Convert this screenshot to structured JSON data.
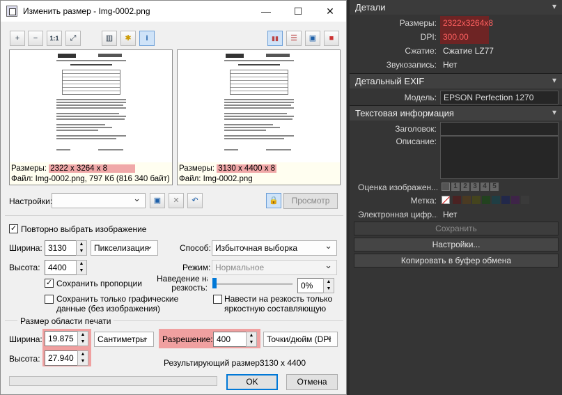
{
  "window": {
    "title": "Изменить размер - Img-0002.png",
    "minimize": "—",
    "maximize": "☐",
    "close": "✕"
  },
  "toolbar": {
    "zoom_in": "+",
    "zoom_out": "−",
    "one_to_one": "1:1",
    "fit": "⤢",
    "histogram": "▥",
    "effects": "✱",
    "info": "i",
    "view_side": "▮▮",
    "view_stack": "☰",
    "view_single": "▣",
    "view_after": "■"
  },
  "previews": {
    "left": {
      "size_label": "Размеры:",
      "size_value": "2322 x 3264 x 8",
      "file_line": "Файл: Img-0002.png, 797 Кб (816 340 байт)"
    },
    "right": {
      "size_label": "Размеры:",
      "size_value": "3130 x 4400 x 8",
      "file_line": "Файл: Img-0002.png"
    }
  },
  "settings": {
    "label": "Настройки:",
    "value": "",
    "preview_button": "Просмотр"
  },
  "reselect": {
    "label": "Повторно выбрать изображение",
    "checked": true
  },
  "size": {
    "width_label": "Ширина:",
    "width_value": "3130",
    "height_label": "Высота:",
    "height_value": "4400",
    "unit": "Пикселизация",
    "keep_ratio_label": "Сохранить пропорции",
    "keep_ratio_checked": true,
    "graphic_only_label_1": "Сохранить только графические",
    "graphic_only_label_2": "данные (без изображения)",
    "graphic_only_checked": false
  },
  "method": {
    "label": "Способ:",
    "value": "Избыточная выборка",
    "mode_label": "Режим:",
    "mode_value": "Нормальное",
    "sharpen_label_1": "Наведение на",
    "sharpen_label_2": "резкость:",
    "sharpen_value": "0%",
    "sharpen_level": 0,
    "sharpen_bright_label_1": "Навести на резкость только",
    "sharpen_bright_label_2": "яркостную составляющую",
    "sharpen_bright_checked": false
  },
  "print": {
    "group_label": "Размер области печати",
    "width_label": "Ширина:",
    "width_value": "19.875",
    "height_label": "Высота:",
    "height_value": "27.940",
    "unit": "Сантиметры",
    "resolution_label": "Разрешение:",
    "resolution_value": "400",
    "resolution_unit": "Точки/дюйм (DPI",
    "result_label": "Результирующий размер:",
    "result_value": "3130 x 4400"
  },
  "footer": {
    "ok": "OK",
    "cancel": "Отмена"
  },
  "panel": {
    "details_header": "Детали",
    "dims_label": "Размеры:",
    "dims_value": "2322x3264x8",
    "dpi_label": "DPI:",
    "dpi_value": "300.00",
    "compression_label": "Сжатие:",
    "compression_value": "Сжатие LZ77",
    "audio_label": "Звукозапись:",
    "audio_value": "Нет",
    "exif_header": "Детальный EXIF",
    "model_label": "Модель:",
    "model_value": "EPSON Perfection 1270",
    "text_header": "Текстовая информация",
    "heading_label": "Заголовок:",
    "heading_value": "",
    "description_label": "Описание:",
    "description_value": "",
    "rating_label": "Оценка изображен...",
    "ratings": [
      "1",
      "2",
      "3",
      "4",
      "5"
    ],
    "mark_label": "Метка:",
    "mark_colors": [
      "#4a2222",
      "#4a3a22",
      "#44441e",
      "#22421f",
      "#1f3e44",
      "#22284a",
      "#3e2448",
      "#3a3a3a"
    ],
    "digital_label": "Электронная цифр...",
    "digital_value": "Нет",
    "save_button": "Сохранить",
    "settings_button": "Настройки...",
    "copy_button": "Копировать в буфер обмена"
  },
  "colors": {
    "highlight": "#f0a8a8",
    "panel_highlight": "#7a2a2a"
  }
}
